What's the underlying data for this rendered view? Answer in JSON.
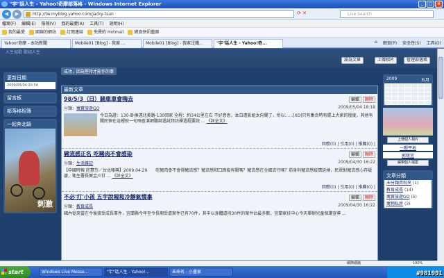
{
  "window": {
    "title": "\"宇\"話人生 - Yahoo!奇摩部落格 - Windows Internet Explorer"
  },
  "address": {
    "url": "http://tw.myblog.yahoo.com/jacky-tsun",
    "search_placeholder": "Live Search"
  },
  "menu": [
    "檔案(F)",
    "編輯(E)",
    "檢視(V)",
    "我的最愛(A)",
    "工具(T)",
    "說明(H)"
  ],
  "favorites": [
    {
      "label": "我的最愛"
    },
    {
      "label": "國錦的網站"
    },
    {
      "label": "訂閱連結"
    },
    {
      "label": "免費的 Hotmail"
    },
    {
      "label": "網頁快訊藝廊"
    }
  ],
  "tabs": [
    {
      "label": "Yahoo!奇摩 - 本站新聞"
    },
    {
      "label": "Mobile01 [Blog] - 我家 ..."
    },
    {
      "label": "Mobile01 [Blog] - 我家注鐵..."
    },
    {
      "label": "\"宇\"話人生 - Yahoo!奇..."
    }
  ],
  "tab_tools": [
    "網頁(P)",
    "安全性(S)",
    "工具(O)"
  ],
  "blog": {
    "subtitle": "人生如歌 歌如人生",
    "header_buttons": [
      "設為文章",
      "上傳相片",
      "管理部落格"
    ],
    "status_msg": "成功，因為堅持才能作的事"
  },
  "left": {
    "update_title": "更新日期",
    "update_date": "2009/05/04 20:54",
    "guestbook": "留言板",
    "links": "部落格相簿",
    "ride": "一起奔北騎",
    "ride_text": "刺激"
  },
  "main": {
    "section_title": "最新文章",
    "edit": "編輯",
    "delete": "刪除",
    "posts": [
      {
        "title": "98/5/3（日）騎車車會嗨去",
        "category": "寓實旅遊GO",
        "date": "2009/05/04 18:18",
        "body": "今日為證：130-卧撫遠北美路-130回家 全程：約34公里左右 不好意思，本日遭影組太向關了，所以......[XD]只有集合時有擺上大家的慢度，其他有關民宿在這裡就一句嗨查演網聽調過試拜訪揮過程要說 ...",
        "more": "《詳全文》",
        "footer": "回應(0) | 引用(0) | 推薦(0) |"
      },
      {
        "title": "豬流感正名 吃豬肉不會感染",
        "category": "生活雜記",
        "date": "2009/04/30 16:22",
        "body": "【中國時報 莊蕙芬／台北報導】2009.04.29　　吃豬肉會不會得豬流感？豬流感和口蹄疫有關嗎？豬流感在全國流行嗎？前身利豬流感疫情延燒，民眾對豬流感心存疑慮，衛生署長葉金川甘 ...",
        "more": "《詳全文》",
        "footer": "回應(0) | 引用(0) | 推薦(0) |"
      },
      {
        "title": "不必'打'小孩 五宇說報和冷靜氣憤事",
        "category": "教育成長",
        "date": "2009/04/30 16:22",
        "body": "國內從來當在今後接受成長事件，宜蘭縣今年至今長期受虐案件已有70件，其中以身體虐待30件的案件佔最多數，宜蘭家扶中心今天舉辦兒童保護宣導 ..."
      }
    ]
  },
  "right": {
    "cal_year": "2009",
    "cal_month": "五月",
    "upload_btn": "上傳個人相片",
    "link": "一鄰平地",
    "profile": "郭喀宜",
    "edit_profile": "編輯個人檔案",
    "cat_title": "文章分類",
    "categories": [
      {
        "name": "未分類資料夾",
        "count": "(1)"
      },
      {
        "name": "教育成長",
        "count": "(14)"
      },
      {
        "name": "寓實旅遊GO",
        "count": "(5)"
      },
      {
        "name": "寓物私房",
        "count": "(3)"
      }
    ]
  },
  "statusbar": {
    "zone": "網際網路",
    "zoom": "100%"
  },
  "taskbar": {
    "start": "start",
    "tasks": [
      {
        "label": "Windows Live Messe..."
      },
      {
        "label": "\"宇\"話人生 - Yahoo!..."
      },
      {
        "label": "未命名 - 小畫家"
      }
    ],
    "watermark": "#981901"
  }
}
